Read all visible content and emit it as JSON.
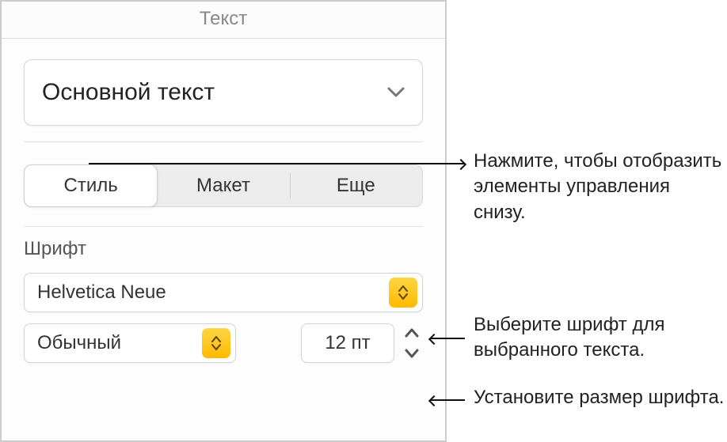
{
  "panel": {
    "title": "Текст",
    "paragraph_style": "Основной текст",
    "tabs": {
      "style": "Стиль",
      "layout": "Макет",
      "more": "Еще"
    },
    "font_section_label": "Шрифт",
    "font_family": "Helvetica Neue",
    "font_weight": "Обычный",
    "font_size": "12 пт"
  },
  "callouts": {
    "tabs": "Нажмите, чтобы отобразить элементы управления снизу.",
    "font_family": "Выберите шрифт для выбранного текста.",
    "font_size": "Установите размер шрифта."
  }
}
